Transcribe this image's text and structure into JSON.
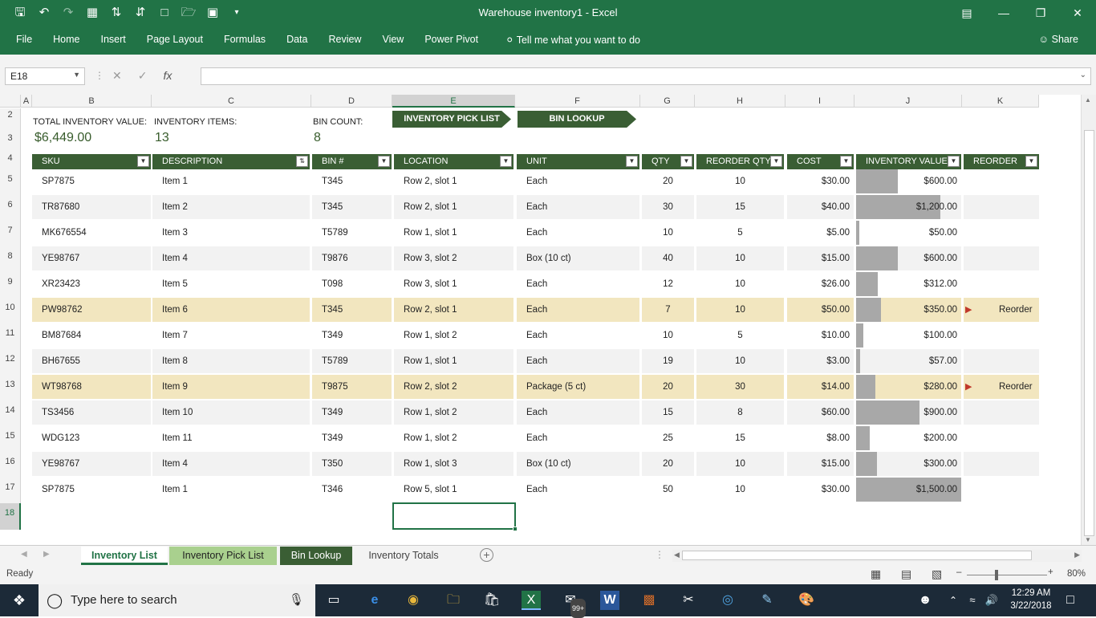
{
  "window": {
    "title": "Warehouse inventory1  -  Excel"
  },
  "ribbon": {
    "tabs": [
      "File",
      "Home",
      "Insert",
      "Page Layout",
      "Formulas",
      "Data",
      "Review",
      "View",
      "Power Pivot"
    ],
    "tell_me": "Tell me what you want to do",
    "share": "Share"
  },
  "formula_bar": {
    "name_box": "E18",
    "fx": "fx",
    "value": ""
  },
  "columns": [
    "A",
    "B",
    "C",
    "D",
    "E",
    "F",
    "G",
    "H",
    "I",
    "J",
    "K"
  ],
  "rows": [
    "2",
    "3",
    "4",
    "5",
    "6",
    "7",
    "8",
    "9",
    "10",
    "11",
    "12",
    "13",
    "14",
    "15",
    "16",
    "17",
    "18"
  ],
  "summary": {
    "total_value_label": "TOTAL INVENTORY VALUE:",
    "total_value": "$6,449.00",
    "items_label": "INVENTORY ITEMS:",
    "items": "13",
    "bin_count_label": "BIN COUNT:",
    "bin_count": "8",
    "pick_list_button": "INVENTORY PICK LIST",
    "bin_lookup_button": "BIN LOOKUP"
  },
  "table": {
    "headers": [
      "SKU",
      "DESCRIPTION",
      "BIN #",
      "LOCATION",
      "UNIT",
      "QTY",
      "REORDER QTY",
      "COST",
      "INVENTORY VALUE",
      "REORDER"
    ],
    "rows": [
      {
        "sku": "SP7875",
        "desc": "Item 1",
        "bin": "T345",
        "loc": "Row 2, slot 1",
        "unit": "Each",
        "qty": "20",
        "rq": "10",
        "cost": "$30.00",
        "value": "$600.00",
        "v": 600,
        "reorder": ""
      },
      {
        "sku": "TR87680",
        "desc": "Item 2",
        "bin": "T345",
        "loc": "Row 2, slot 1",
        "unit": "Each",
        "qty": "30",
        "rq": "15",
        "cost": "$40.00",
        "value": "$1,200.00",
        "v": 1200,
        "reorder": ""
      },
      {
        "sku": "MK676554",
        "desc": "Item 3",
        "bin": "T5789",
        "loc": "Row 1, slot 1",
        "unit": "Each",
        "qty": "10",
        "rq": "5",
        "cost": "$5.00",
        "value": "$50.00",
        "v": 50,
        "reorder": ""
      },
      {
        "sku": "YE98767",
        "desc": "Item 4",
        "bin": "T9876",
        "loc": "Row 3, slot 2",
        "unit": "Box (10 ct)",
        "qty": "40",
        "rq": "10",
        "cost": "$15.00",
        "value": "$600.00",
        "v": 600,
        "reorder": ""
      },
      {
        "sku": "XR23423",
        "desc": "Item 5",
        "bin": "T098",
        "loc": "Row 3, slot 1",
        "unit": "Each",
        "qty": "12",
        "rq": "10",
        "cost": "$26.00",
        "value": "$312.00",
        "v": 312,
        "reorder": ""
      },
      {
        "sku": "PW98762",
        "desc": "Item 6",
        "bin": "T345",
        "loc": "Row 2, slot 1",
        "unit": "Each",
        "qty": "7",
        "rq": "10",
        "cost": "$50.00",
        "value": "$350.00",
        "v": 350,
        "reorder": "Reorder"
      },
      {
        "sku": "BM87684",
        "desc": "Item 7",
        "bin": "T349",
        "loc": "Row 1, slot 2",
        "unit": "Each",
        "qty": "10",
        "rq": "5",
        "cost": "$10.00",
        "value": "$100.00",
        "v": 100,
        "reorder": ""
      },
      {
        "sku": "BH67655",
        "desc": "Item 8",
        "bin": "T5789",
        "loc": "Row 1, slot 1",
        "unit": "Each",
        "qty": "19",
        "rq": "10",
        "cost": "$3.00",
        "value": "$57.00",
        "v": 57,
        "reorder": ""
      },
      {
        "sku": "WT98768",
        "desc": "Item 9",
        "bin": "T9875",
        "loc": "Row 2, slot 2",
        "unit": "Package (5 ct)",
        "qty": "20",
        "rq": "30",
        "cost": "$14.00",
        "value": "$280.00",
        "v": 280,
        "reorder": "Reorder"
      },
      {
        "sku": "TS3456",
        "desc": "Item 10",
        "bin": "T349",
        "loc": "Row 1, slot 2",
        "unit": "Each",
        "qty": "15",
        "rq": "8",
        "cost": "$60.00",
        "value": "$900.00",
        "v": 900,
        "reorder": ""
      },
      {
        "sku": "WDG123",
        "desc": "Item 11",
        "bin": "T349",
        "loc": "Row 1, slot 2",
        "unit": "Each",
        "qty": "25",
        "rq": "15",
        "cost": "$8.00",
        "value": "$200.00",
        "v": 200,
        "reorder": ""
      },
      {
        "sku": "YE98767",
        "desc": "Item 4",
        "bin": "T350",
        "loc": "Row 1, slot 3",
        "unit": "Box (10 ct)",
        "qty": "20",
        "rq": "10",
        "cost": "$15.00",
        "value": "$300.00",
        "v": 300,
        "reorder": ""
      },
      {
        "sku": "SP7875",
        "desc": "Item 1",
        "bin": "T346",
        "loc": "Row 5, slot 1",
        "unit": "Each",
        "qty": "50",
        "rq": "10",
        "cost": "$30.00",
        "value": "$1,500.00",
        "v": 1500,
        "reorder": ""
      }
    ]
  },
  "sheet_tabs": [
    "Inventory List",
    "Inventory Pick List",
    "Bin Lookup",
    "Inventory Totals"
  ],
  "status": {
    "ready": "Ready",
    "zoom": "80%"
  },
  "taskbar": {
    "search_placeholder": "Type here to search",
    "time": "12:29 AM",
    "date": "3/22/2018",
    "mail_badge": "99+"
  },
  "colors": {
    "excel_green": "#217346",
    "header_green": "#3a5e34",
    "reorder_highlight": "#f2e6bf",
    "databar": "#a8a8a8"
  }
}
